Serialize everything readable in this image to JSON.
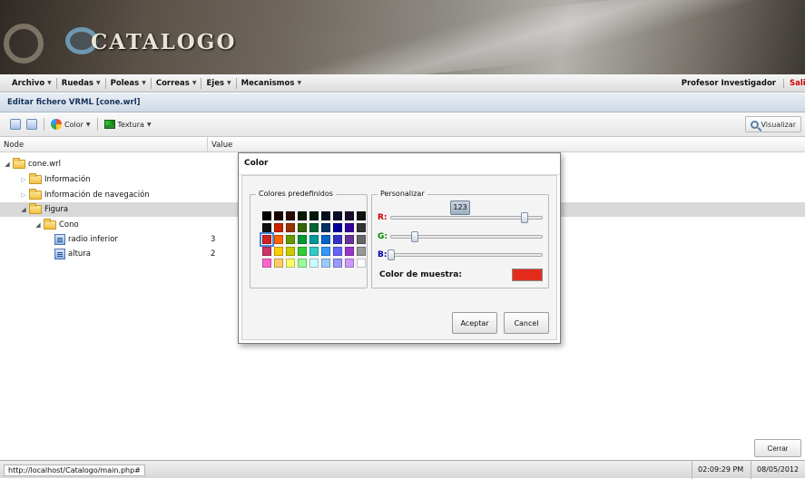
{
  "app": {
    "logo_text": "CATALOGO"
  },
  "menu": {
    "items": [
      {
        "label": "Archivo"
      },
      {
        "label": "Ruedas"
      },
      {
        "label": "Poleas"
      },
      {
        "label": "Correas"
      },
      {
        "label": "Ejes"
      },
      {
        "label": "Mecanismos"
      }
    ],
    "user": "Profesor Investigador",
    "logout": "Salir"
  },
  "panel": {
    "title": "Editar fichero VRML [cone.wrl]"
  },
  "toolbar": {
    "color_label": "Color",
    "texture_label": "Textura",
    "visualize_label": "Visualizar"
  },
  "tree": {
    "col_node": "Node",
    "col_value": "Value",
    "rows": [
      {
        "label": "cone.wrl",
        "value": ""
      },
      {
        "label": "Información",
        "value": ""
      },
      {
        "label": "Información de navegación",
        "value": ""
      },
      {
        "label": "Figura",
        "value": ""
      },
      {
        "label": "Cono",
        "value": ""
      },
      {
        "label": "radio inferior",
        "value": "3"
      },
      {
        "label": "altura",
        "value": "2"
      }
    ]
  },
  "dialog": {
    "title": "Color",
    "predef_legend": "Colores predefinidos",
    "custom_legend": "Personalizar",
    "swatches": [
      "#000000",
      "#1a0000",
      "#2a0a00",
      "#0a1a00",
      "#001a0a",
      "#00101a",
      "#0a0a2a",
      "#1a0a2a",
      "#101010",
      "#101010",
      "#cc2200",
      "#993300",
      "#336600",
      "#006633",
      "#003366",
      "#000099",
      "#330099",
      "#333333",
      "#cc2222",
      "#ff6600",
      "#669900",
      "#009933",
      "#009999",
      "#0066cc",
      "#3333cc",
      "#663399",
      "#666666",
      "#cc3366",
      "#ffcc00",
      "#cccc00",
      "#33cc33",
      "#33cccc",
      "#3399ff",
      "#6666ff",
      "#9933cc",
      "#999999",
      "#ff66cc",
      "#ffcc66",
      "#ffff66",
      "#99ff99",
      "#ccffff",
      "#99ccff",
      "#9999ff",
      "#cc99ff",
      "#ffffff"
    ],
    "tooltip_value": "123",
    "channels": {
      "r": "R:",
      "g": "G:",
      "b": "B:"
    },
    "rgb": {
      "r": 226,
      "g": 40,
      "b": 0
    },
    "sample_label": "Color de muestra:",
    "sample_color": "#e32c1c",
    "accept_label": "Aceptar",
    "cancel_label": "Cancel"
  },
  "footer": {
    "close_label": "Cerrar"
  },
  "status": {
    "url": "http://localhost/Catalogo/main.php#",
    "time": "02:09:29 PM",
    "date": "08/05/2012"
  }
}
